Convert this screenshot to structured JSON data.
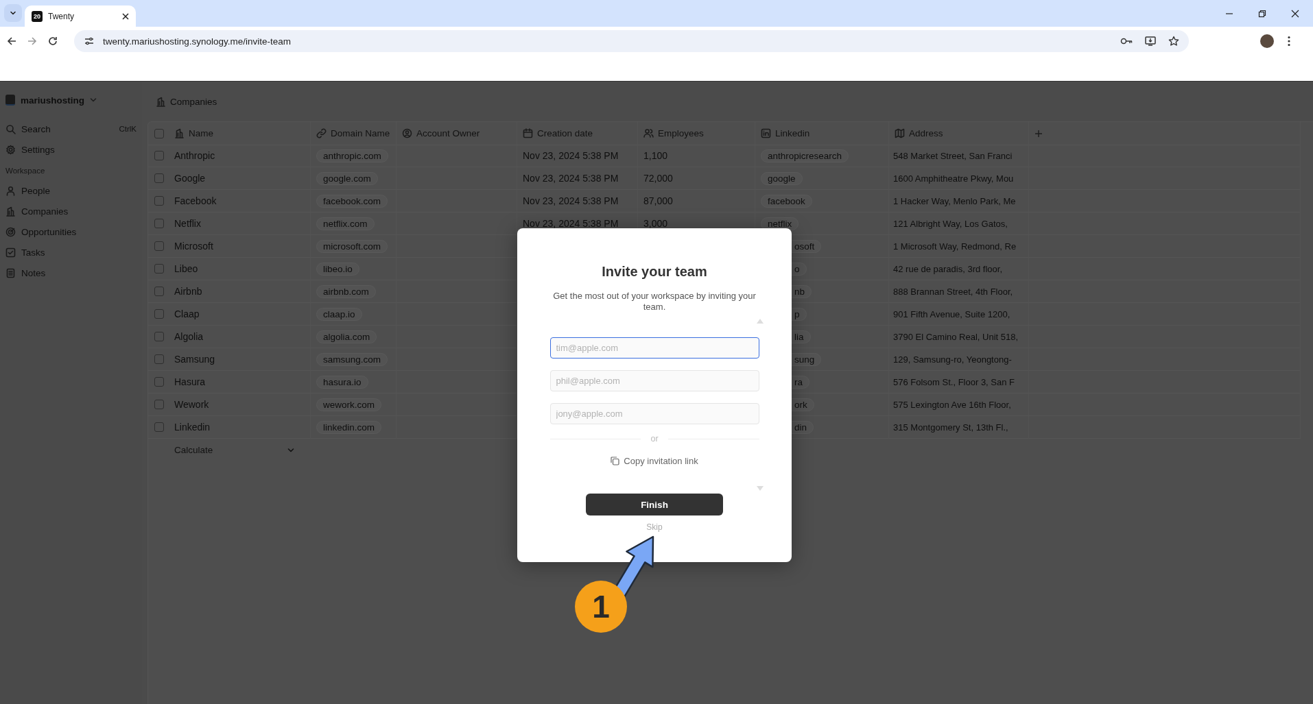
{
  "browser": {
    "tab": {
      "favicon": "20",
      "title": "Twenty"
    },
    "url": "twenty.mariushosting.synology.me/invite-team"
  },
  "sidebar": {
    "workspace": "mariushosting",
    "items": [
      {
        "label": "Search",
        "shortcut": "CtrlK"
      },
      {
        "label": "Settings"
      }
    ],
    "section": "Workspace",
    "workspace_items": [
      {
        "label": "People"
      },
      {
        "label": "Companies"
      },
      {
        "label": "Opportunities"
      },
      {
        "label": "Tasks"
      },
      {
        "label": "Notes"
      }
    ]
  },
  "page_title": "Companies",
  "table": {
    "all_selected": false,
    "columns": [
      "Name",
      "Domain Name",
      "Account Owner",
      "Creation date",
      "Employees",
      "Linkedin",
      "Address"
    ],
    "rows": [
      {
        "selected": false,
        "name": "Anthropic",
        "domain": "anthropic.com",
        "creation_date": "Nov 23, 2024 5:38 PM",
        "employees": "1,100",
        "linkedin": {
          "text": "anthropicresearch",
          "covered": false
        },
        "address": "548 Market Street, San Franci"
      },
      {
        "selected": false,
        "name": "Google",
        "domain": "google.com",
        "creation_date": "Nov 23, 2024 5:38 PM",
        "employees": "72,000",
        "linkedin": {
          "text": "google",
          "covered": false
        },
        "address": "1600 Amphitheatre Pkwy, Mou"
      },
      {
        "selected": false,
        "name": "Facebook",
        "domain": "facebook.com",
        "creation_date": "Nov 23, 2024 5:38 PM",
        "employees": "87,000",
        "linkedin": {
          "text": "facebook",
          "covered": false
        },
        "address": "1 Hacker Way, Menlo Park, Me"
      },
      {
        "selected": false,
        "name": "Netflix",
        "domain": "netflix.com",
        "creation_date": "Nov 23, 2024 5:38 PM",
        "employees": "3,000",
        "linkedin": {
          "text": "netflix",
          "covered": false
        },
        "address": "121 Albright Way, Los Gatos,"
      },
      {
        "selected": false,
        "name": "Microsoft",
        "domain": "microsoft.com",
        "linkedin": {
          "text": "osoft",
          "covered": true
        },
        "address": "1 Microsoft Way, Redmond, Re"
      },
      {
        "selected": false,
        "name": "Libeo",
        "domain": "libeo.io",
        "linkedin": {
          "text": "o",
          "covered": true
        },
        "address": "42 rue de paradis, 3rd floor,"
      },
      {
        "selected": false,
        "name": "Airbnb",
        "domain": "airbnb.com",
        "linkedin": {
          "text": "nb",
          "covered": true
        },
        "address": "888 Brannan Street, 4th Floor,"
      },
      {
        "selected": false,
        "name": "Claap",
        "domain": "claap.io",
        "linkedin": {
          "text": "p",
          "covered": true
        },
        "address": "901 Fifth Avenue, Suite 1200,"
      },
      {
        "selected": false,
        "name": "Algolia",
        "domain": "algolia.com",
        "linkedin": {
          "text": "lia",
          "covered": true
        },
        "address": "3790 El Camino Real, Unit 518,"
      },
      {
        "selected": false,
        "name": "Samsung",
        "domain": "samsung.com",
        "linkedin": {
          "text": "sung",
          "covered": true
        },
        "address": "129, Samsung-ro, Yeongtong-"
      },
      {
        "selected": false,
        "name": "Hasura",
        "domain": "hasura.io",
        "linkedin": {
          "text": "ra",
          "covered": true
        },
        "address": "576 Folsom St., Floor 3, San F"
      },
      {
        "selected": false,
        "name": "Wework",
        "domain": "wework.com",
        "linkedin": {
          "text": "ork",
          "covered": true
        },
        "address": "575 Lexington Ave 16th Floor,"
      },
      {
        "selected": false,
        "name": "Linkedin",
        "domain": "linkedin.com",
        "linkedin": {
          "text": "din",
          "covered": true
        },
        "address": "315 Montgomery St, 13th Fl.,"
      }
    ],
    "footer": "Calculate"
  },
  "modal": {
    "title": "Invite your team",
    "description": "Get the most out of your workspace by inviting your team.",
    "inputs": [
      {
        "placeholder": "tim@apple.com",
        "focused": true
      },
      {
        "placeholder": "phil@apple.com",
        "focused": false
      },
      {
        "placeholder": "jony@apple.com",
        "focused": false
      }
    ],
    "divider": "or",
    "copy_link": "Copy invitation link",
    "primary": "Finish",
    "secondary": "Skip"
  },
  "annotation": {
    "number": "1"
  }
}
